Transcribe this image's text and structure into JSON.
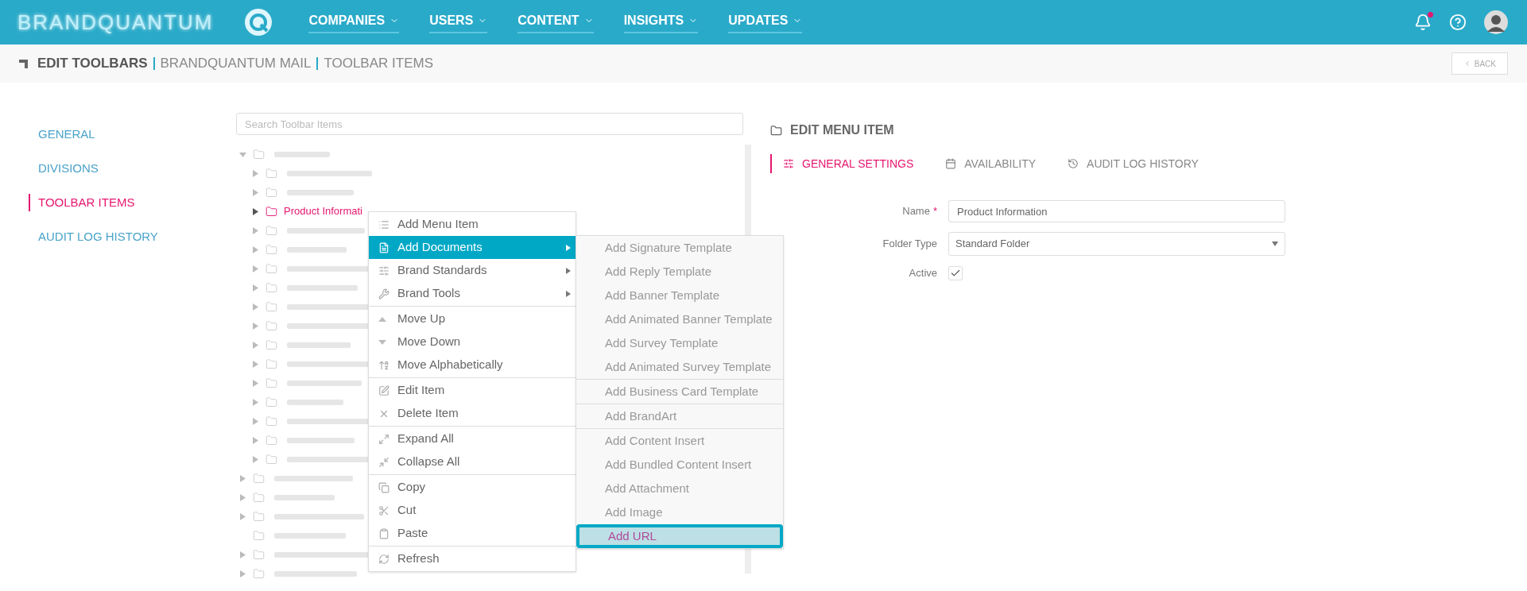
{
  "header": {
    "logo": "BRANDQUANTUM",
    "nav": [
      {
        "label": "COMPANIES"
      },
      {
        "label": "USERS"
      },
      {
        "label": "CONTENT"
      },
      {
        "label": "INSIGHTS"
      },
      {
        "label": "UPDATES"
      }
    ],
    "notification_unread": true
  },
  "breadcrumb": {
    "items": [
      "EDIT TOOLBARS",
      "BRANDQUANTUM MAIL",
      "TOOLBAR ITEMS"
    ],
    "back": "BACK"
  },
  "sidebar": {
    "items": [
      {
        "label": "GENERAL",
        "selected": false
      },
      {
        "label": "DIVISIONS",
        "selected": false
      },
      {
        "label": "TOOLBAR ITEMS",
        "selected": true
      },
      {
        "label": "AUDIT LOG HISTORY",
        "selected": false
      }
    ]
  },
  "search": {
    "placeholder": "Search Toolbar Items"
  },
  "tree": [
    {
      "selected": false,
      "expandable": true,
      "expanded": true,
      "children": [
        {
          "selected": false,
          "expandable": true,
          "expanded": false
        },
        {
          "selected": false,
          "expandable": true,
          "expanded": false
        },
        {
          "label": "Product Informati",
          "selected": true,
          "expandable": true,
          "expanded": false
        },
        {
          "selected": false,
          "expandable": true,
          "expanded": false
        },
        {
          "selected": false,
          "expandable": true,
          "expanded": false
        },
        {
          "selected": false,
          "expandable": true,
          "expanded": false
        },
        {
          "selected": false,
          "expandable": true,
          "expanded": false
        },
        {
          "selected": false,
          "expandable": true,
          "expanded": false
        },
        {
          "selected": false,
          "expandable": true,
          "expanded": false
        },
        {
          "selected": false,
          "expandable": true,
          "expanded": false
        },
        {
          "selected": false,
          "expandable": true,
          "expanded": false
        },
        {
          "selected": false,
          "expandable": true,
          "expanded": false
        },
        {
          "selected": false,
          "expandable": true,
          "expanded": false
        },
        {
          "selected": false,
          "expandable": true,
          "expanded": false
        },
        {
          "selected": false,
          "expandable": true,
          "expanded": false
        },
        {
          "selected": false,
          "expandable": true,
          "expanded": false
        }
      ]
    },
    {
      "selected": false,
      "expandable": true,
      "expanded": false
    },
    {
      "selected": false,
      "expandable": true,
      "expanded": false
    },
    {
      "selected": false,
      "expandable": true,
      "expanded": false
    },
    {
      "selected": false,
      "expandable": false,
      "expanded": false
    },
    {
      "selected": false,
      "expandable": true,
      "expanded": false
    },
    {
      "selected": false,
      "expandable": true,
      "expanded": false
    }
  ],
  "context_menu": {
    "groups": [
      [
        {
          "label": "Add Menu Item",
          "selected": false,
          "submenu": false
        },
        {
          "label": "Add Documents",
          "selected": true,
          "submenu": true
        },
        {
          "label": "Brand Standards",
          "selected": false,
          "submenu": true
        },
        {
          "label": "Brand Tools",
          "selected": false,
          "submenu": true
        }
      ],
      [
        {
          "label": "Move Up",
          "selected": false,
          "submenu": false
        },
        {
          "label": "Move Down",
          "selected": false,
          "submenu": false
        },
        {
          "label": "Move Alphabetically",
          "selected": false,
          "submenu": false
        }
      ],
      [
        {
          "label": "Edit Item",
          "selected": false,
          "submenu": false
        },
        {
          "label": "Delete Item",
          "selected": false,
          "submenu": false
        }
      ],
      [
        {
          "label": "Expand All",
          "selected": false,
          "submenu": false
        },
        {
          "label": "Collapse All",
          "selected": false,
          "submenu": false
        }
      ],
      [
        {
          "label": "Copy",
          "selected": false,
          "submenu": false
        },
        {
          "label": "Cut",
          "selected": false,
          "submenu": false
        },
        {
          "label": "Paste",
          "selected": false,
          "submenu": false
        }
      ],
      [
        {
          "label": "Refresh",
          "selected": false,
          "submenu": false
        }
      ]
    ]
  },
  "submenu": {
    "groups": [
      [
        {
          "label": "Add Signature Template",
          "selected": false
        },
        {
          "label": "Add Reply Template",
          "selected": false
        },
        {
          "label": "Add Banner Template",
          "selected": false
        },
        {
          "label": "Add Animated Banner Template",
          "selected": false
        },
        {
          "label": "Add Survey Template",
          "selected": false
        },
        {
          "label": "Add Animated Survey Template",
          "selected": false
        }
      ],
      [
        {
          "label": "Add Business Card Template",
          "selected": false
        }
      ],
      [
        {
          "label": "Add BrandArt",
          "selected": false
        }
      ],
      [
        {
          "label": "Add Content Insert",
          "selected": false
        },
        {
          "label": "Add Bundled Content Insert",
          "selected": false
        },
        {
          "label": "Add Attachment",
          "selected": false
        },
        {
          "label": "Add Image",
          "selected": false
        },
        {
          "label": "Add URL",
          "selected": true
        }
      ]
    ]
  },
  "editor": {
    "title": "EDIT MENU ITEM",
    "tabs": [
      {
        "label": "GENERAL SETTINGS",
        "selected": true
      },
      {
        "label": "AVAILABILITY",
        "selected": false
      },
      {
        "label": "AUDIT LOG HISTORY",
        "selected": false
      }
    ],
    "fields": [
      {
        "kind": "text",
        "label": "Name",
        "required_mark": "*",
        "value": "Product Information"
      },
      {
        "kind": "select",
        "label": "Folder Type",
        "value": "Standard Folder"
      },
      {
        "kind": "checkbox",
        "label": "Active",
        "checked": true
      }
    ]
  }
}
